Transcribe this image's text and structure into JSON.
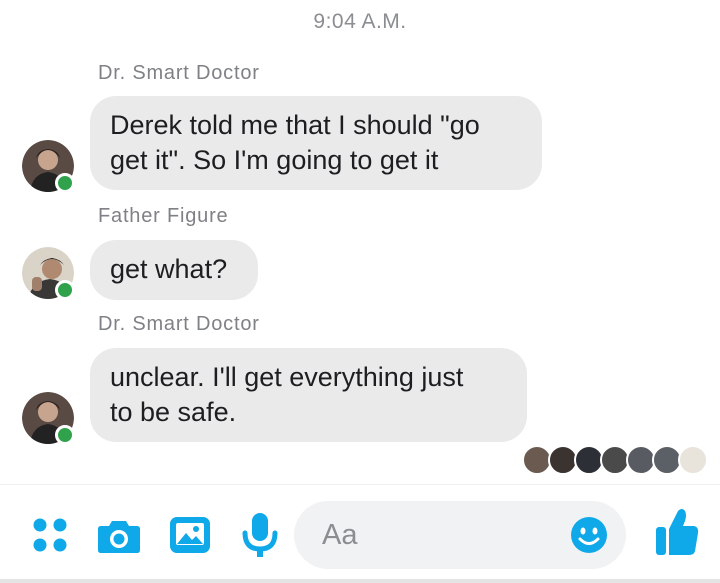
{
  "timestamp": "9:04 A.M.",
  "messages": [
    {
      "sender": "Dr. Smart Doctor",
      "text_lines": [
        "Derek told me that I should \"go",
        "get it\". So I'm going to get it"
      ]
    },
    {
      "sender": "Father Figure",
      "text_lines": [
        "get what?"
      ]
    },
    {
      "sender": "Dr. Smart Doctor",
      "text_lines": [
        "unclear. I'll get everything just",
        "to be safe."
      ]
    }
  ],
  "composer": {
    "placeholder": "Aa",
    "accent_color": "#0fa8e8",
    "icons": [
      "apps-icon",
      "camera-icon",
      "gallery-icon",
      "microphone-icon",
      "emoji-icon",
      "thumbs-up-icon"
    ]
  },
  "status_colors": {
    "online": "#31a24c",
    "bubble": "#eaeaea"
  }
}
